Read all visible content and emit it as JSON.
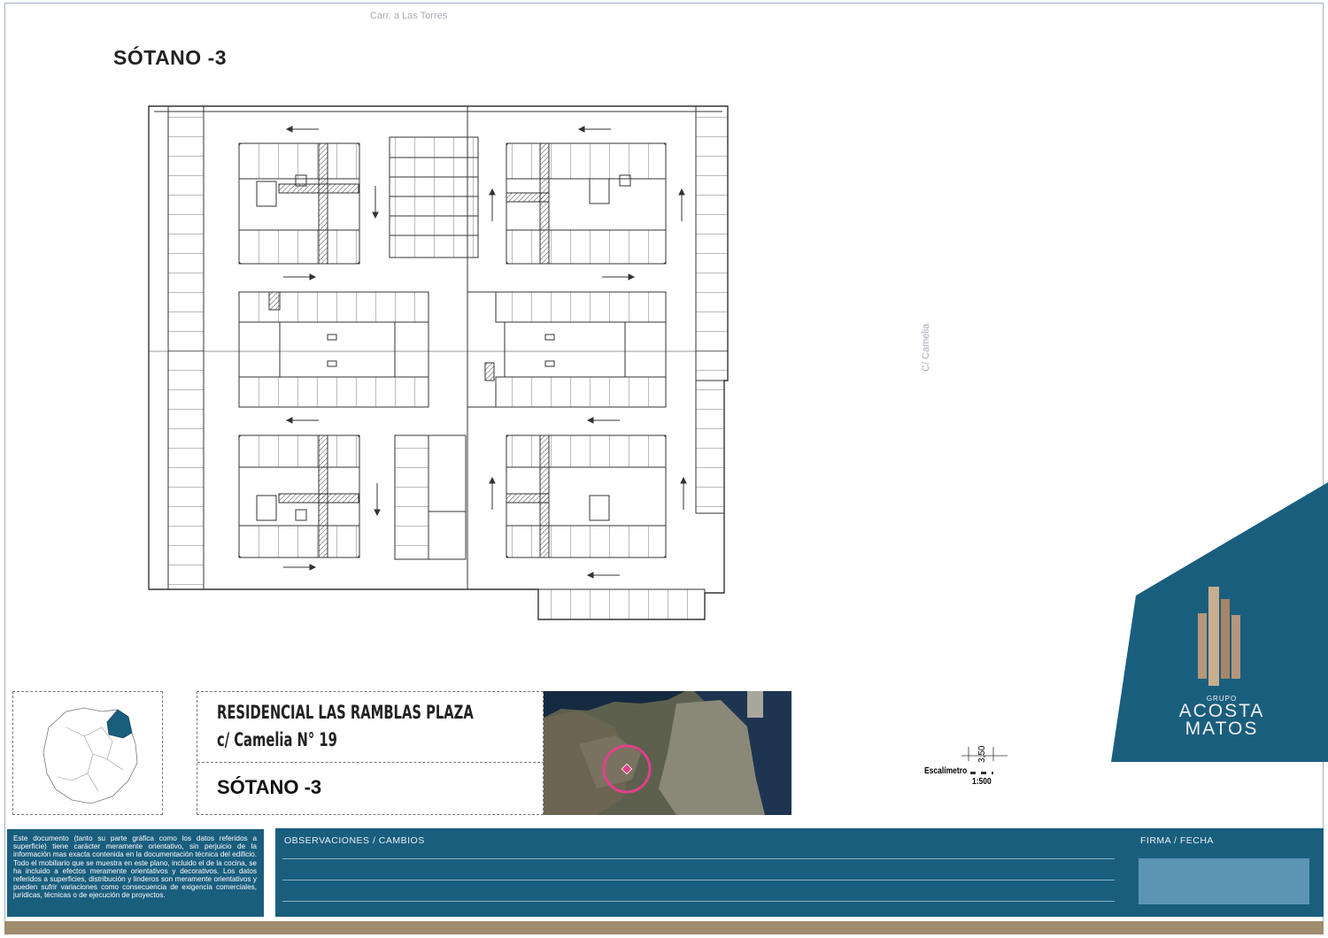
{
  "roads": {
    "top": "Carr. a Las Torres",
    "side": "C/ Camelia"
  },
  "plan_title": "SÓTANO -3",
  "info": {
    "project_line1": "RESIDENCIAL LAS RAMBLAS PLAZA",
    "project_line2": "c/ Camelia N° 19",
    "level": "SÓTANO -3"
  },
  "scale": {
    "label": "Escalímetro",
    "value": "3,50",
    "ratio": "1:500"
  },
  "logo": {
    "group": "GRUPO",
    "name1": "ACOSTA",
    "name2": "MATOS"
  },
  "colors": {
    "brand_blue": "#1a5e7e",
    "brand_gold": "#a08b6e",
    "highlight": "#e0408a"
  },
  "disclaimer": "Este documento (tanto su parte gráfica como los datos referidos a superficie) tiene carácter meramente orientativo, sin perjuicio de la información mas exacta contenida en la documentación técnica del edificio. Todo el mobiliario que se muestra en este plano, incluido el de la cocina, se ha incluido a efectos meramente orientativos y decorativos. Los datos referidos a superficies, distribución y linderos son meramente orientativos y pueden sufrir variaciones como consecuencia de exigencia comerciales, jurídicas, técnicas o de ejecución de proyectos.",
  "observations": {
    "title": "OBSERVACIONES / CAMBIOS",
    "signature_title": "FIRMA / FECHA"
  }
}
